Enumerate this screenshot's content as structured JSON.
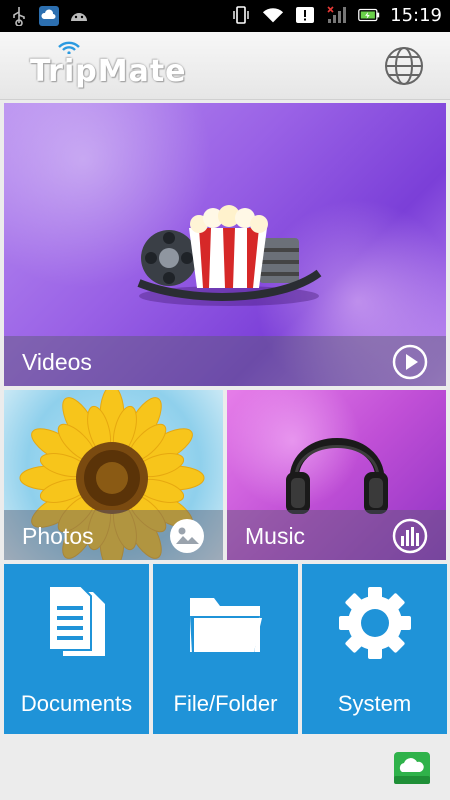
{
  "status_bar": {
    "time": "15:19",
    "icons": [
      "usb-icon",
      "cloud-notify-icon",
      "android-icon",
      "vibrate-icon",
      "wifi-icon",
      "alert-icon",
      "signal-icon",
      "battery-icon"
    ]
  },
  "header": {
    "logo_text": "TripMate",
    "globe_icon": "globe-icon"
  },
  "tiles": {
    "videos": {
      "label": "Videos",
      "icon": "play-icon"
    },
    "photos": {
      "label": "Photos",
      "icon": "photo-icon"
    },
    "music": {
      "label": "Music",
      "icon": "equalizer-icon"
    },
    "documents": {
      "label": "Documents",
      "icon": "documents-icon"
    },
    "files": {
      "label": "File/Folder",
      "icon": "folder-icon"
    },
    "system": {
      "label": "System",
      "icon": "gear-icon"
    }
  },
  "colors": {
    "tile_blue": "#1f93d8",
    "footer_cloud_green": "#2fb24a"
  }
}
